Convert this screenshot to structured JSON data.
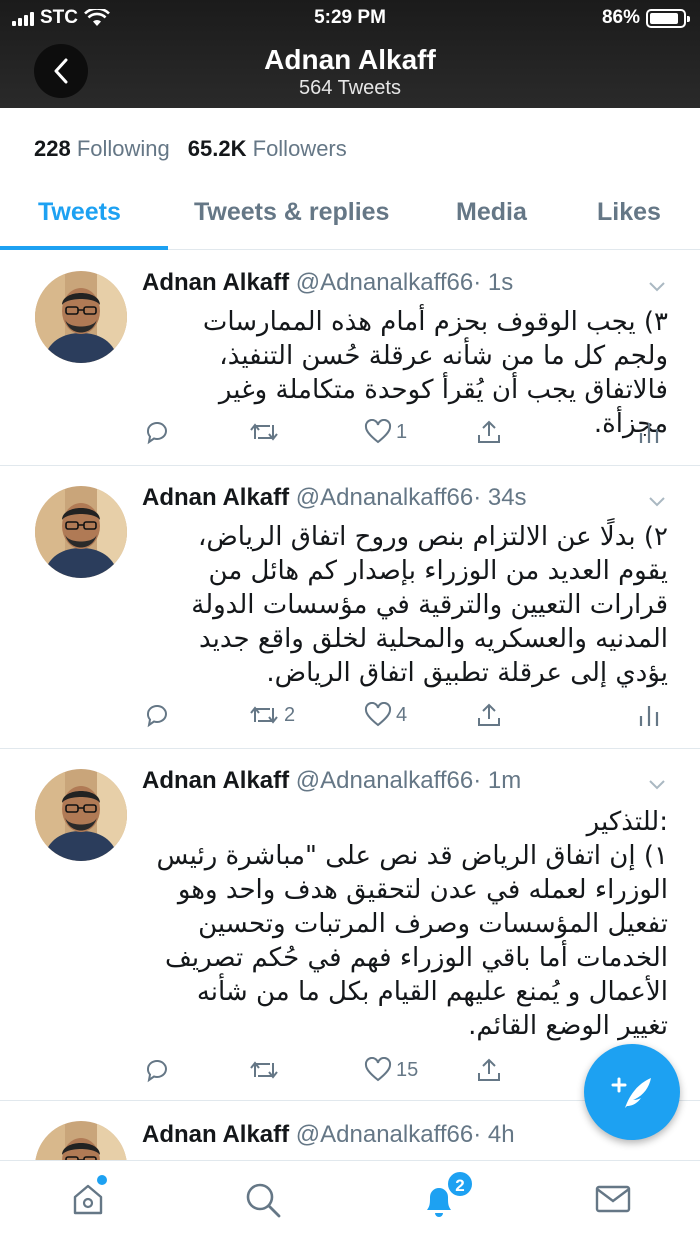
{
  "status_bar": {
    "carrier": "STC",
    "time": "5:29 PM",
    "battery": "86%",
    "battery_level": 0.86
  },
  "header": {
    "title": "Adnan Alkaff",
    "subtitle": "564 Tweets"
  },
  "profile": {
    "following_count": "228",
    "following_label": "Following",
    "followers_count": "65.2K",
    "followers_label": "Followers"
  },
  "tabs": [
    {
      "label": "Tweets",
      "active": true
    },
    {
      "label": "Tweets & replies",
      "active": false
    },
    {
      "label": "Media",
      "active": false
    },
    {
      "label": "Likes",
      "active": false
    }
  ],
  "tweets": [
    {
      "name": "Adnan Alkaff",
      "handle": "@Adnanalkaff66",
      "time": "· 1s",
      "text": "٣) يجب الوقوف بحزم أمام هذه الممارسات ولجم كل ما من شأنه عرقلة حُسن التنفيذ، فالاتفاق يجب أن يُقرأ  كوحدة متكاملة وغير مجزأة.",
      "replies": "",
      "retweets": "",
      "likes": "1"
    },
    {
      "name": "Adnan Alkaff",
      "handle": "@Adnanalkaff66",
      "time": "· 34s",
      "text": "٢) بدلًا  عن الالتزام بنص وروح اتفاق الرياض، يقوم العديد من الوزراء بإصدار كم هائل من قرارات التعيين والترقية في مؤسسات الدولة المدنيه والعسكريه والمحلية  لخلق واقع جديد يؤدي إلى عرقلة تطبيق اتفاق الرياض.",
      "replies": "",
      "retweets": "2",
      "likes": "4"
    },
    {
      "name": "Adnan Alkaff",
      "handle": "@Adnanalkaff66",
      "time": "· 1m",
      "text": ":للتذكير\n١) إن اتفاق الرياض قد نص على \"مباشرة رئيس الوزراء لعمله في عدن لتحقيق هدف واحد وهو تفعيل المؤسسات وصرف المرتبات وتحسين الخدمات أما باقي الوزراء فهم في حُكم تصريف الأعمال و يُمنع عليهم القيام بكل ما من شأنه تغيير الوضع القائم.",
      "replies": "",
      "retweets": "",
      "likes": "15"
    },
    {
      "name": "Adnan Alkaff",
      "handle": "@Adnanalkaff66",
      "time": "· 4h",
      "text": "",
      "replies": "",
      "retweets": "",
      "likes": ""
    }
  ],
  "bottom_nav": {
    "notifications_badge": "2"
  },
  "colors": {
    "accent": "#1da1f2",
    "muted": "#657786",
    "text": "#14171a"
  }
}
